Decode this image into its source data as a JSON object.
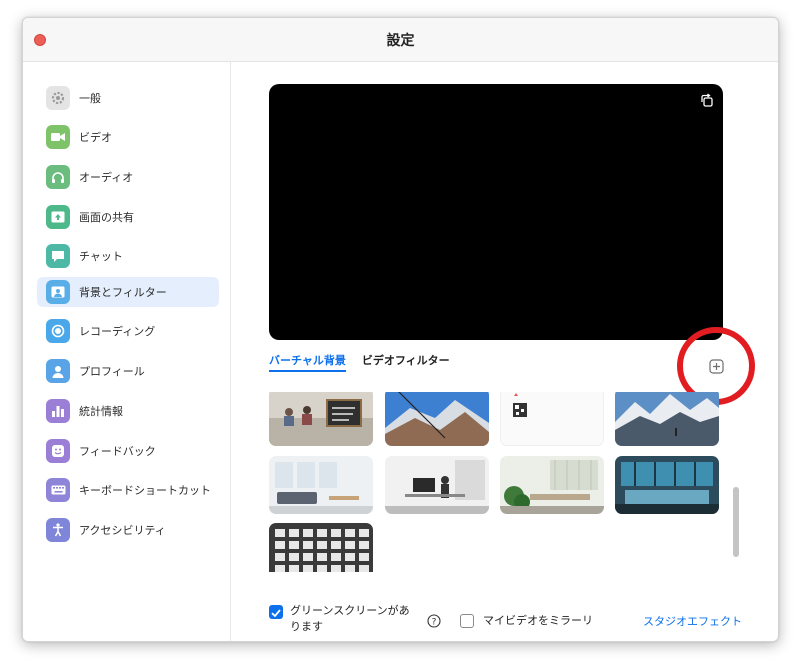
{
  "window": {
    "title": "設定"
  },
  "sidebar": {
    "items": [
      {
        "label": "一般",
        "icon": "gear-icon",
        "color": "#e8e8e8"
      },
      {
        "label": "ビデオ",
        "icon": "video-camera-icon",
        "color": "#7ec26a"
      },
      {
        "label": "オーディオ",
        "icon": "headphones-icon",
        "color": "#6bbd7f"
      },
      {
        "label": "画面の共有",
        "icon": "screen-share-icon",
        "color": "#4db88a"
      },
      {
        "label": "チャット",
        "icon": "chat-bubble-icon",
        "color": "#4db8a5"
      },
      {
        "label": "背景とフィルター",
        "icon": "background-portrait-icon",
        "color": "#5aaee8"
      },
      {
        "label": "レコーディング",
        "icon": "record-icon",
        "color": "#4aa8ea"
      },
      {
        "label": "プロフィール",
        "icon": "person-icon",
        "color": "#58a4e6"
      },
      {
        "label": "統計情報",
        "icon": "bar-chart-icon",
        "color": "#9b7fd6"
      },
      {
        "label": "フィードバック",
        "icon": "smiley-icon",
        "color": "#9b7fd6"
      },
      {
        "label": "キーボードショートカット",
        "icon": "keyboard-icon",
        "color": "#8f85d8"
      },
      {
        "label": "アクセシビリティ",
        "icon": "accessibility-icon",
        "color": "#7f85d8"
      }
    ],
    "active_index": 5
  },
  "main": {
    "tabs": [
      {
        "label": "バーチャル背景",
        "active": true
      },
      {
        "label": "ビデオフィルター",
        "active": false
      }
    ],
    "accent_color": "#0e71eb",
    "highlight_color": "#e11d22"
  },
  "options": {
    "green_screen_label": "グリーンスクリーンがあります",
    "green_screen_checked": true,
    "mirror_label": "マイビデオをミラーリ",
    "mirror_checked": false,
    "studio_effects_label": "スタジオエフェクト"
  }
}
